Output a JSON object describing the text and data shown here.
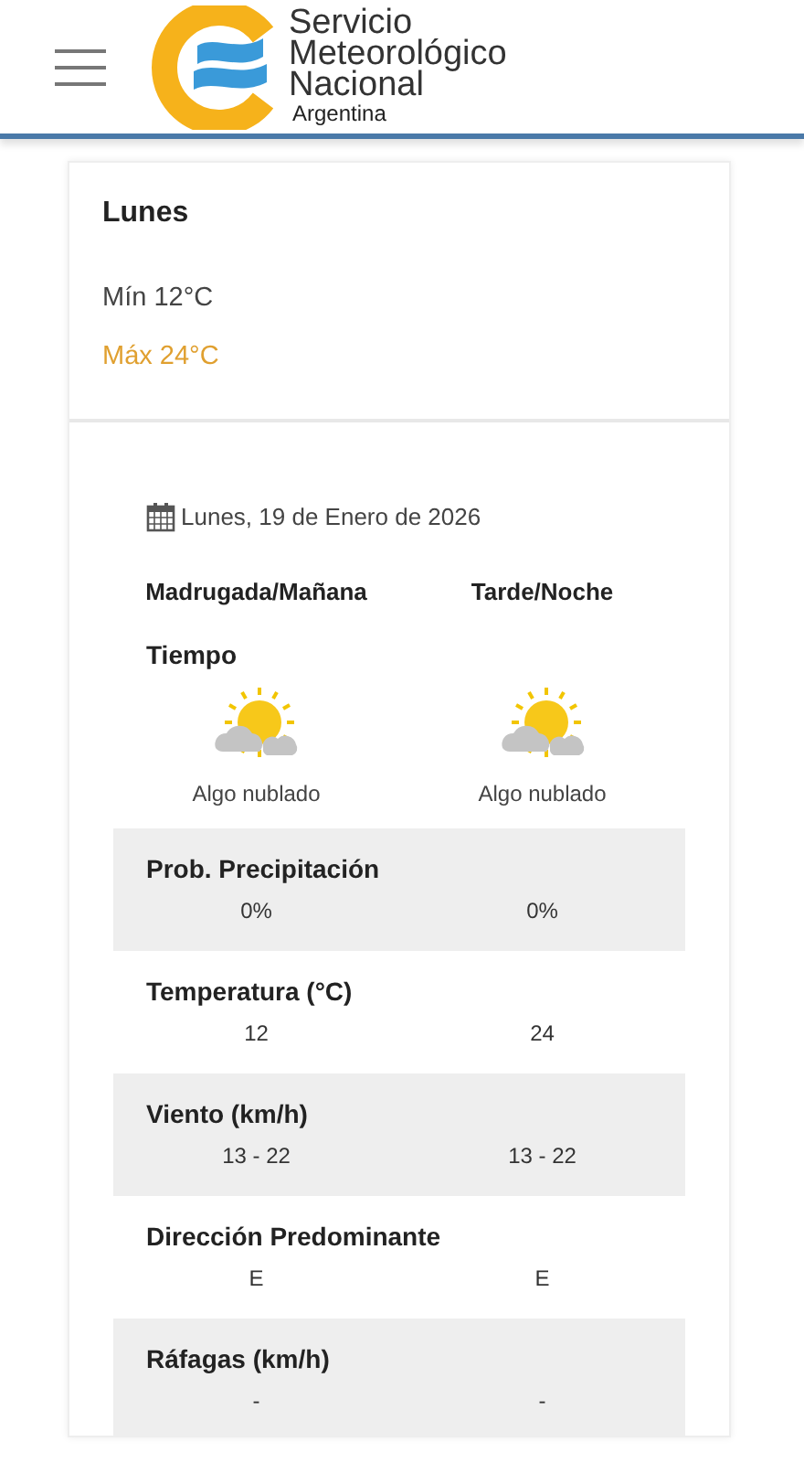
{
  "header": {
    "logo_lines": [
      "Servicio",
      "Meteorológico",
      "Nacional"
    ],
    "logo_sub": "Argentina"
  },
  "day": {
    "name": "Lunes",
    "min": "Mín 12°C",
    "max": "Máx 24°C"
  },
  "detail": {
    "date": "Lunes, 19 de Enero de 2026",
    "periods": [
      "Madrugada/Mañana",
      "Tarde/Noche"
    ],
    "weather_label": "Tiempo",
    "weather": [
      {
        "description": "Algo nublado"
      },
      {
        "description": "Algo nublado"
      }
    ],
    "rows": [
      {
        "label": "Prob. Precipitación",
        "values": [
          "0%",
          "0%"
        ]
      },
      {
        "label": "Temperatura (°C)",
        "values": [
          "12",
          "24"
        ]
      },
      {
        "label": "Viento (km/h)",
        "values": [
          "13 - 22",
          "13 - 22"
        ]
      },
      {
        "label": "Dirección Predominante",
        "values": [
          "E",
          "E"
        ]
      },
      {
        "label": "Ráfagas (km/h)",
        "values": [
          "-",
          "-"
        ]
      }
    ]
  }
}
